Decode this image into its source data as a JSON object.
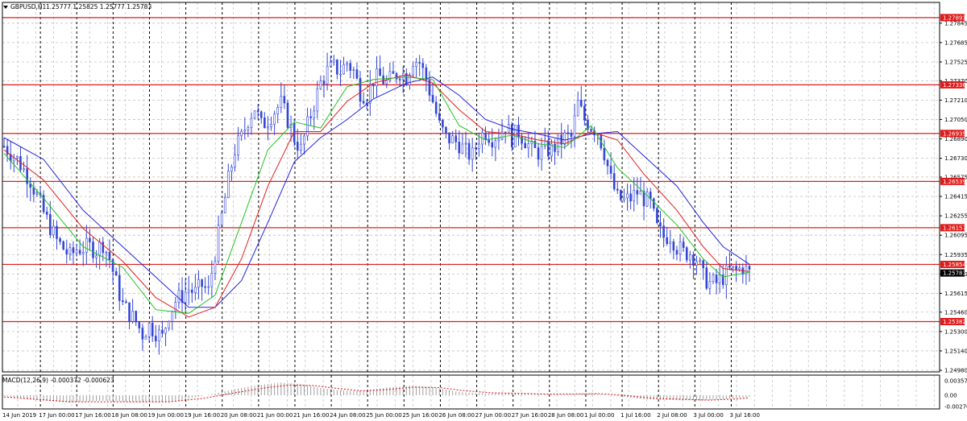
{
  "window": {
    "symbol_tf": "GBPUSD,H1",
    "ohlc": "1.25777 1.25825 1.25777 1.25783",
    "menu_icon": "triangle-down-icon"
  },
  "macd_panel": {
    "title": "MACD(12,26,9) -0.000372 -0.000623",
    "y_ticks": [
      "0.003576",
      "0.00",
      "-0.002764"
    ]
  },
  "colors": {
    "candles": "#3346d6",
    "ma_fast": "#22c322",
    "ma_mid": "#e02020",
    "ma_slow": "#2222dd",
    "hline": "#e01b1b",
    "tag_bg": "#e01b1b",
    "current_tag_bg": "#000000",
    "grid": "#c4c4c4",
    "sessions": "#000000",
    "macd_hist": "#a0a0a0",
    "macd_signal": "#dd1111"
  },
  "chart_data": {
    "type": "candlestick",
    "symbol": "GBPUSD",
    "timeframe": "H1",
    "ylim": [
      1.2498,
      1.2795
    ],
    "y_ticks": [
      "1.27845",
      "1.27685",
      "1.27525",
      "1.27370",
      "1.27210",
      "1.27050",
      "1.26890",
      "1.26730",
      "1.26575",
      "1.26415",
      "1.26255",
      "1.26095",
      "1.25935",
      "1.25775",
      "1.25615",
      "1.25460",
      "1.25300",
      "1.25140",
      "1.24980"
    ],
    "x_labels": [
      "14 Jun 2019",
      "17 Jun 00:00",
      "17 Jun 16:00",
      "18 Jun 08:00",
      "19 Jun 00:00",
      "19 Jun 16:00",
      "20 Jun 08:00",
      "21 Jun 00:00",
      "21 Jun 16:00",
      "24 Jun 08:00",
      "25 Jun 00:00",
      "25 Jun 16:00",
      "26 Jun 08:00",
      "27 Jun 00:00",
      "27 Jun 16:00",
      "28 Jun 08:00",
      "1 Jul 00:00",
      "1 Jul 16:00",
      "2 Jul 08:00",
      "3 Jul 00:00",
      "3 Jul 16:00"
    ],
    "horizontal_levels": [
      1.27891,
      1.27336,
      1.26935,
      1.26539,
      1.26157,
      1.25854,
      1.25382
    ],
    "level_tags": [
      "1.27891",
      "1.27336",
      "1.26935",
      "1.26539",
      "1.26157",
      "1.25854",
      "1.25382"
    ],
    "current_price": 1.25783,
    "current_tag": "1.25783",
    "close_path": [
      [
        0,
        1.2683
      ],
      [
        4,
        1.2672
      ],
      [
        8,
        1.2655
      ],
      [
        12,
        1.2628
      ],
      [
        16,
        1.2605
      ],
      [
        20,
        1.2592
      ],
      [
        22,
        1.2598
      ],
      [
        26,
        1.26
      ],
      [
        28,
        1.2597
      ],
      [
        30,
        1.2603
      ],
      [
        32,
        1.259
      ],
      [
        34,
        1.257
      ],
      [
        36,
        1.2552
      ],
      [
        38,
        1.2545
      ],
      [
        40,
        1.2538
      ],
      [
        42,
        1.2528
      ],
      [
        44,
        1.2535
      ],
      [
        46,
        1.253
      ],
      [
        48,
        1.2525
      ],
      [
        50,
        1.2545
      ],
      [
        52,
        1.2555
      ],
      [
        54,
        1.256
      ],
      [
        56,
        1.2565
      ],
      [
        58,
        1.2562
      ],
      [
        60,
        1.2568
      ],
      [
        62,
        1.2563
      ],
      [
        64,
        1.2595
      ],
      [
        66,
        1.2625
      ],
      [
        68,
        1.2655
      ],
      [
        70,
        1.268
      ],
      [
        72,
        1.269
      ],
      [
        74,
        1.2705
      ],
      [
        76,
        1.2715
      ],
      [
        78,
        1.27
      ],
      [
        80,
        1.2705
      ],
      [
        82,
        1.2712
      ],
      [
        84,
        1.2718
      ],
      [
        86,
        1.2705
      ],
      [
        88,
        1.269
      ],
      [
        90,
        1.268
      ],
      [
        92,
        1.27
      ],
      [
        94,
        1.2718
      ],
      [
        96,
        1.2735
      ],
      [
        98,
        1.2745
      ],
      [
        100,
        1.2748
      ],
      [
        102,
        1.2745
      ],
      [
        104,
        1.2752
      ],
      [
        106,
        1.2745
      ],
      [
        108,
        1.2728
      ],
      [
        110,
        1.2725
      ],
      [
        112,
        1.2738
      ],
      [
        114,
        1.274
      ],
      [
        116,
        1.2735
      ],
      [
        118,
        1.274
      ],
      [
        120,
        1.2745
      ],
      [
        122,
        1.274
      ],
      [
        124,
        1.2755
      ],
      [
        126,
        1.2752
      ],
      [
        128,
        1.2738
      ],
      [
        130,
        1.272
      ],
      [
        132,
        1.27
      ],
      [
        134,
        1.269
      ],
      [
        136,
        1.2688
      ],
      [
        138,
        1.2685
      ],
      [
        140,
        1.2678
      ],
      [
        142,
        1.2675
      ],
      [
        144,
        1.269
      ],
      [
        146,
        1.2695
      ],
      [
        148,
        1.269
      ],
      [
        150,
        1.2693
      ],
      [
        152,
        1.27
      ],
      [
        154,
        1.269
      ],
      [
        156,
        1.2695
      ],
      [
        158,
        1.2688
      ],
      [
        160,
        1.268
      ],
      [
        162,
        1.2678
      ],
      [
        164,
        1.268
      ],
      [
        166,
        1.268
      ],
      [
        168,
        1.2685
      ],
      [
        170,
        1.269
      ],
      [
        172,
        1.269
      ],
      [
        174,
        1.2718
      ],
      [
        176,
        1.2705
      ],
      [
        178,
        1.27
      ],
      [
        180,
        1.2695
      ],
      [
        182,
        1.2678
      ],
      [
        184,
        1.2655
      ],
      [
        186,
        1.264
      ],
      [
        188,
        1.2638
      ],
      [
        190,
        1.264
      ],
      [
        192,
        1.2645
      ],
      [
        194,
        1.264
      ],
      [
        196,
        1.2635
      ],
      [
        198,
        1.2615
      ],
      [
        200,
        1.2608
      ],
      [
        202,
        1.261
      ],
      [
        204,
        1.26
      ],
      [
        206,
        1.2595
      ],
      [
        208,
        1.2595
      ],
      [
        210,
        1.259
      ],
      [
        212,
        1.2575
      ],
      [
        214,
        1.257
      ],
      [
        216,
        1.257
      ],
      [
        218,
        1.2575
      ],
      [
        220,
        1.258
      ],
      [
        222,
        1.258
      ],
      [
        224,
        1.2583
      ],
      [
        226,
        1.25783
      ]
    ],
    "ma_fast_path": [
      [
        0,
        1.2677
      ],
      [
        12,
        1.264
      ],
      [
        24,
        1.26
      ],
      [
        36,
        1.2583
      ],
      [
        46,
        1.2548
      ],
      [
        56,
        1.2545
      ],
      [
        64,
        1.256
      ],
      [
        72,
        1.262
      ],
      [
        80,
        1.268
      ],
      [
        88,
        1.2703
      ],
      [
        96,
        1.2698
      ],
      [
        104,
        1.2732
      ],
      [
        112,
        1.2738
      ],
      [
        122,
        1.274
      ],
      [
        130,
        1.2738
      ],
      [
        138,
        1.27
      ],
      [
        146,
        1.2688
      ],
      [
        154,
        1.2692
      ],
      [
        162,
        1.2685
      ],
      [
        170,
        1.2682
      ],
      [
        178,
        1.27
      ],
      [
        186,
        1.2665
      ],
      [
        194,
        1.2645
      ],
      [
        204,
        1.2618
      ],
      [
        212,
        1.259
      ],
      [
        218,
        1.2575
      ],
      [
        226,
        1.2579
      ]
    ],
    "ma_mid_path": [
      [
        0,
        1.268
      ],
      [
        12,
        1.2655
      ],
      [
        24,
        1.2615
      ],
      [
        36,
        1.2588
      ],
      [
        46,
        1.2558
      ],
      [
        56,
        1.2542
      ],
      [
        64,
        1.255
      ],
      [
        72,
        1.259
      ],
      [
        80,
        1.265
      ],
      [
        88,
        1.2695
      ],
      [
        96,
        1.2695
      ],
      [
        104,
        1.272
      ],
      [
        112,
        1.2735
      ],
      [
        122,
        1.2742
      ],
      [
        130,
        1.2735
      ],
      [
        138,
        1.2713
      ],
      [
        146,
        1.2695
      ],
      [
        154,
        1.2693
      ],
      [
        162,
        1.2688
      ],
      [
        170,
        1.2685
      ],
      [
        178,
        1.2695
      ],
      [
        186,
        1.2688
      ],
      [
        194,
        1.266
      ],
      [
        204,
        1.263
      ],
      [
        212,
        1.26
      ],
      [
        218,
        1.2582
      ],
      [
        226,
        1.25795
      ]
    ],
    "ma_slow_path": [
      [
        0,
        1.269
      ],
      [
        12,
        1.2672
      ],
      [
        24,
        1.263
      ],
      [
        36,
        1.26
      ],
      [
        46,
        1.2575
      ],
      [
        56,
        1.255
      ],
      [
        64,
        1.255
      ],
      [
        72,
        1.2572
      ],
      [
        80,
        1.262
      ],
      [
        88,
        1.267
      ],
      [
        96,
        1.269
      ],
      [
        104,
        1.2705
      ],
      [
        112,
        1.2722
      ],
      [
        122,
        1.2735
      ],
      [
        130,
        1.274
      ],
      [
        138,
        1.2725
      ],
      [
        146,
        1.2705
      ],
      [
        154,
        1.2697
      ],
      [
        162,
        1.2693
      ],
      [
        170,
        1.2688
      ],
      [
        178,
        1.2693
      ],
      [
        186,
        1.2695
      ],
      [
        194,
        1.2675
      ],
      [
        204,
        1.265
      ],
      [
        212,
        1.262
      ],
      [
        218,
        1.26
      ],
      [
        226,
        1.25855
      ]
    ],
    "macd_ylim": [
      -0.002764,
      0.003576
    ],
    "macd_hist_path": [
      [
        0,
        -0.0002
      ],
      [
        10,
        -0.0012
      ],
      [
        20,
        -0.0018
      ],
      [
        30,
        -0.0013
      ],
      [
        40,
        -0.0017
      ],
      [
        50,
        -0.0018
      ],
      [
        60,
        -0.0002
      ],
      [
        70,
        0.0015
      ],
      [
        78,
        0.0026
      ],
      [
        84,
        0.0031
      ],
      [
        90,
        0.0028
      ],
      [
        96,
        0.0018
      ],
      [
        102,
        0.0012
      ],
      [
        108,
        0.001
      ],
      [
        116,
        0.0019
      ],
      [
        124,
        0.0024
      ],
      [
        130,
        0.002
      ],
      [
        138,
        0.0008
      ],
      [
        146,
        0.0004
      ],
      [
        154,
        0.0006
      ],
      [
        160,
        0.0004
      ],
      [
        166,
        0.0002
      ],
      [
        172,
        0.0003
      ],
      [
        178,
        0.0005
      ],
      [
        186,
        -0.0002
      ],
      [
        194,
        -0.001
      ],
      [
        204,
        -0.0012
      ],
      [
        212,
        -0.0013
      ],
      [
        218,
        -0.001
      ],
      [
        226,
        -0.0004
      ]
    ],
    "macd_signal_path": [
      [
        0,
        -0.0004
      ],
      [
        10,
        -0.001
      ],
      [
        20,
        -0.0016
      ],
      [
        30,
        -0.0016
      ],
      [
        40,
        -0.0016
      ],
      [
        50,
        -0.0016
      ],
      [
        60,
        -0.0008
      ],
      [
        70,
        0.0006
      ],
      [
        78,
        0.0017
      ],
      [
        86,
        0.0025
      ],
      [
        94,
        0.0024
      ],
      [
        100,
        0.0018
      ],
      [
        108,
        0.0011
      ],
      [
        116,
        0.0014
      ],
      [
        124,
        0.002
      ],
      [
        132,
        0.0019
      ],
      [
        140,
        0.0011
      ],
      [
        148,
        0.0006
      ],
      [
        156,
        0.0005
      ],
      [
        164,
        0.0003
      ],
      [
        172,
        0.0003
      ],
      [
        180,
        0.0004
      ],
      [
        188,
        0.0
      ],
      [
        196,
        -0.0007
      ],
      [
        206,
        -0.001
      ],
      [
        214,
        -0.0012
      ],
      [
        222,
        -0.0009
      ],
      [
        226,
        -0.0006
      ]
    ]
  }
}
